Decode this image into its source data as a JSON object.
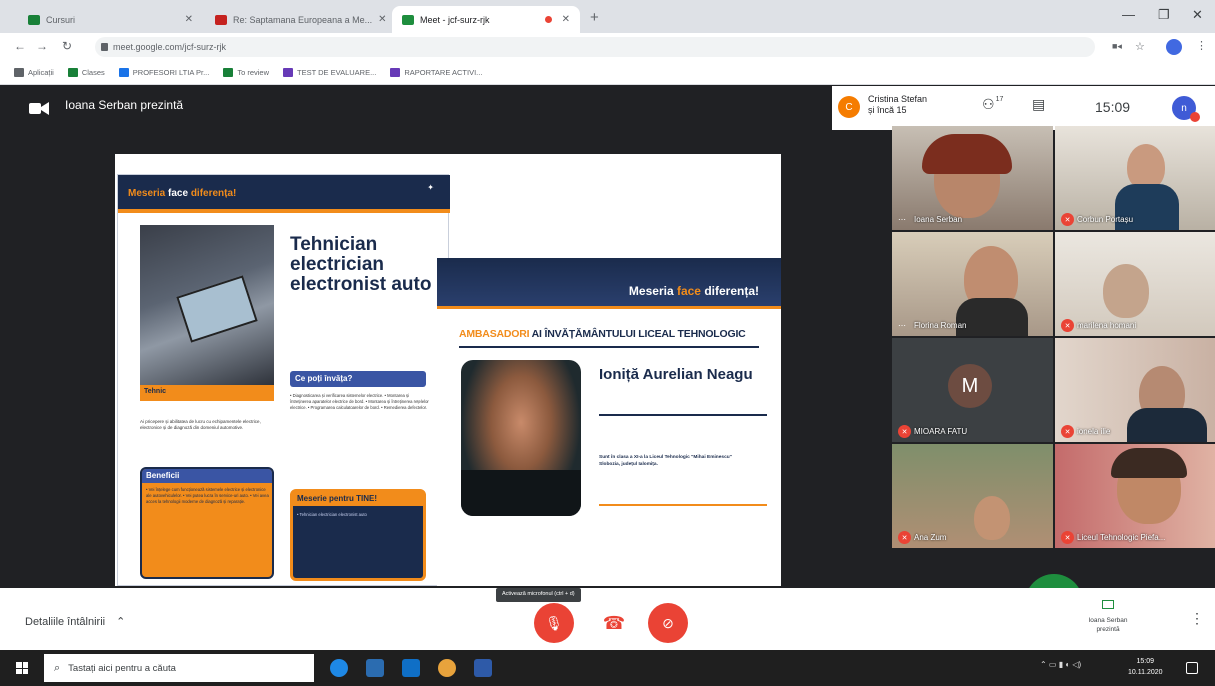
{
  "browser": {
    "tabs": [
      {
        "label": "Cursuri",
        "color": "#188038"
      },
      {
        "label": "Re: Saptamana Europeana a Me...",
        "color": "#c5221f"
      },
      {
        "label": "Meet - jcf-surz-rjk",
        "color": "#1e8e3e"
      }
    ],
    "url": "meet.google.com/jcf-surz-rjk",
    "bookmarks": [
      {
        "label": "Aplicații",
        "color": "#5f6368"
      },
      {
        "label": "Clases",
        "color": "#188038"
      },
      {
        "label": "PROFESORI LTIA Pr...",
        "color": "#1a73e8"
      },
      {
        "label": "To review",
        "color": "#188038"
      },
      {
        "label": "TEST DE EVALUARE...",
        "color": "#673ab7"
      },
      {
        "label": "RAPORTARE ACTIVI...",
        "color": "#673ab7"
      }
    ]
  },
  "meet": {
    "presenter_label": "Ioana Serban prezintă",
    "chip_initial": "C",
    "chip_name_line1": "Cristina Stefan",
    "chip_name_line2": "și încă 15",
    "people_count": "17",
    "clock": "15:09",
    "me_initial": "n"
  },
  "slide": {
    "card1": {
      "banner_prefix": "Meseria ",
      "banner_mid": "face ",
      "banner_suffix": "diferența!",
      "job_title": "Tehnician electrician electronist auto",
      "strip_label": "Tehnic",
      "description": "Ai pricepere și abilitatea de lucru cu echipamentele electrice, electronice și de diagnoză din domeniul automotive.",
      "benefits_head": "Beneficii",
      "benefits_body": "• Vei înțelege cum funcționează sistemele electrice și electronice ale autovehiculelor. • Vei putea lucra în service-uri auto. • Vei avea acces la tehnologii moderne de diagnoză și reparație.",
      "ce_poti_head": "Ce poți învăța?",
      "ce_poti_list": "• Diagnosticarea și verificarea sistemelor electrice. • Montarea și întreținerea aparatelor electrice de bord. • Montarea și întreținerea rețelelor electrice. • Programarea calculatoarelor de bord. • Remedierea defectelor.",
      "pentru_head": "Meserie pentru TINE!",
      "pentru_body": "• Tehnician electrician electronist auto"
    },
    "card2": {
      "banner_prefix": "Meseria ",
      "banner_mid": "face ",
      "banner_suffix": "diferența!",
      "amb_orange": "AMBASADORI ",
      "amb_blue": "AI ÎNVĂȚĂMÂNTULUI LICEAL TEHNOLOGIC",
      "person_name": "Ioniță Aurelian Neagu",
      "person_desc": "Sunt în clasa a XI-a la Liceul Tehnologic \"Mihai Eminescu\" Slobozia, județul Ialomița."
    }
  },
  "tiles": [
    {
      "name": "Ioana Serban",
      "bg": "#8a7a6e",
      "muted": false
    },
    {
      "name": "Corbun Portașu",
      "bg": "#c9c2b5",
      "muted": true
    },
    {
      "name": "Florina Roman",
      "bg": "#b7a99a",
      "muted": false
    },
    {
      "name": "marilena homani",
      "bg": "#d9d2c8",
      "muted": true
    },
    {
      "name": "MIOARA FATU",
      "bg": "#3c4043",
      "muted": true,
      "initial": "M"
    },
    {
      "name": "ionela ilie",
      "bg": "#cfc2b8",
      "muted": true
    },
    {
      "name": "Ana Zum",
      "bg": "#8a9a7a",
      "muted": true
    },
    {
      "name": "Liceul Tehnologic Piefa...",
      "bg": "#b86a6a",
      "muted": true
    }
  ],
  "controls": {
    "details": "Detaliile întâlnirii",
    "tooltip": "Activează microfonul (ctrl + d)",
    "present_line1": "Ioana Serban",
    "present_line2": "prezintă"
  },
  "taskbar": {
    "search_placeholder": "Tastați aici pentru a căuta",
    "time": "15:09",
    "date": "10.11.2020"
  }
}
